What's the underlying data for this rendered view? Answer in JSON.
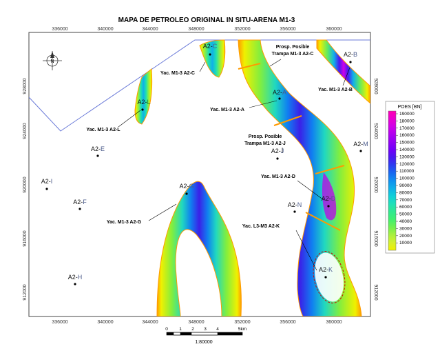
{
  "title": "MAPA DE PETROLEO ORIGINAL IN SITU-ARENA M1-3",
  "x_ticks_top": [
    "336000",
    "340000",
    "344000",
    "348000",
    "352000",
    "356000",
    "360000"
  ],
  "x_ticks_bottom": [
    "336000",
    "340000",
    "344000",
    "348000",
    "352000",
    "356000",
    "360000"
  ],
  "y_ticks_left": [
    "928000",
    "924000",
    "920000",
    "916000",
    "912000"
  ],
  "y_ticks_right": [
    "928000",
    "924000",
    "920000",
    "916000",
    "912000"
  ],
  "wells": [
    {
      "name": "A2-C",
      "color": "#1a1a1a"
    },
    {
      "name": "A2-B",
      "color": "#1a1a1a"
    },
    {
      "name": "A2-L",
      "color": "#2e7d32"
    },
    {
      "name": "A2-A",
      "color": "#1a1a1a"
    },
    {
      "name": "A2-E",
      "color": "#1a1a1a"
    },
    {
      "name": "A2-J",
      "color": "#1a1a1a"
    },
    {
      "name": "A2-M",
      "color": "#1a1a1a"
    },
    {
      "name": "A2-I",
      "color": "#1a1a1a"
    },
    {
      "name": "A2-G",
      "color": "#1a1a1a"
    },
    {
      "name": "A2-F",
      "color": "#1a1a1a"
    },
    {
      "name": "A2-N",
      "color": "#1a1a1a"
    },
    {
      "name": "A2-D",
      "color": "#1a1a1a"
    },
    {
      "name": "A2-K",
      "color": "#1a1a1a"
    },
    {
      "name": "A2-H",
      "color": "#1a1a1a"
    }
  ],
  "annotations": [
    {
      "text": "Yac. M1-3 A2-C"
    },
    {
      "text": "Prosp. Posible"
    },
    {
      "text": "Trampa M1-3 A2-C"
    },
    {
      "text": "Yac. M1-3 A2-B"
    },
    {
      "text": "Yac. M1-3 A2-L"
    },
    {
      "text": "Yac. M1-3 A2-A"
    },
    {
      "text": "Prosp. Posible"
    },
    {
      "text": "Trampa M1-3 A2-J"
    },
    {
      "text": "Yac. M1-3 A2-D"
    },
    {
      "text": "Yac. M1-3 A2-G"
    },
    {
      "text": "Yac. L3-M3 A2-K"
    }
  ],
  "legend": {
    "title": "POES [BN]",
    "values": [
      "190000",
      "180000",
      "170000",
      "160000",
      "150000",
      "140000",
      "130000",
      "120000",
      "110000",
      "100000",
      "90000",
      "80000",
      "70000",
      "60000",
      "50000",
      "40000",
      "30000",
      "20000",
      "10000"
    ],
    "colors": [
      "#ff00b4",
      "#e800d0",
      "#d000e8",
      "#b000f0",
      "#9000f4",
      "#7000f8",
      "#4a18f0",
      "#2a3ef0",
      "#1868f0",
      "#1090f0",
      "#10b0e8",
      "#10d0d8",
      "#20e0b8",
      "#30e890",
      "#40f070",
      "#70f050",
      "#a8f040",
      "#d4f030",
      "#f0f000"
    ]
  },
  "scale": {
    "ticks": [
      "0",
      "1",
      "2",
      "3",
      "4",
      "5km"
    ],
    "ratio": "1:80000"
  },
  "north": "N"
}
